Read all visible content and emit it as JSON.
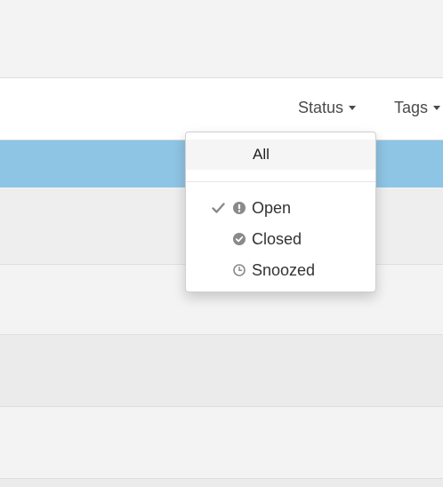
{
  "toolbar": {
    "status_label": "Status",
    "tags_label": "Tags"
  },
  "status_dropdown": {
    "all_label": "All",
    "items": [
      {
        "label": "Open",
        "icon": "exclamation-circle-icon",
        "checked": true
      },
      {
        "label": "Closed",
        "icon": "check-circle-icon",
        "checked": false
      },
      {
        "label": "Snoozed",
        "icon": "clock-icon",
        "checked": false
      }
    ]
  },
  "colors": {
    "selected_row": "#8ec4e4",
    "icon_gray": "#8a8a8a",
    "text": "#333333"
  }
}
